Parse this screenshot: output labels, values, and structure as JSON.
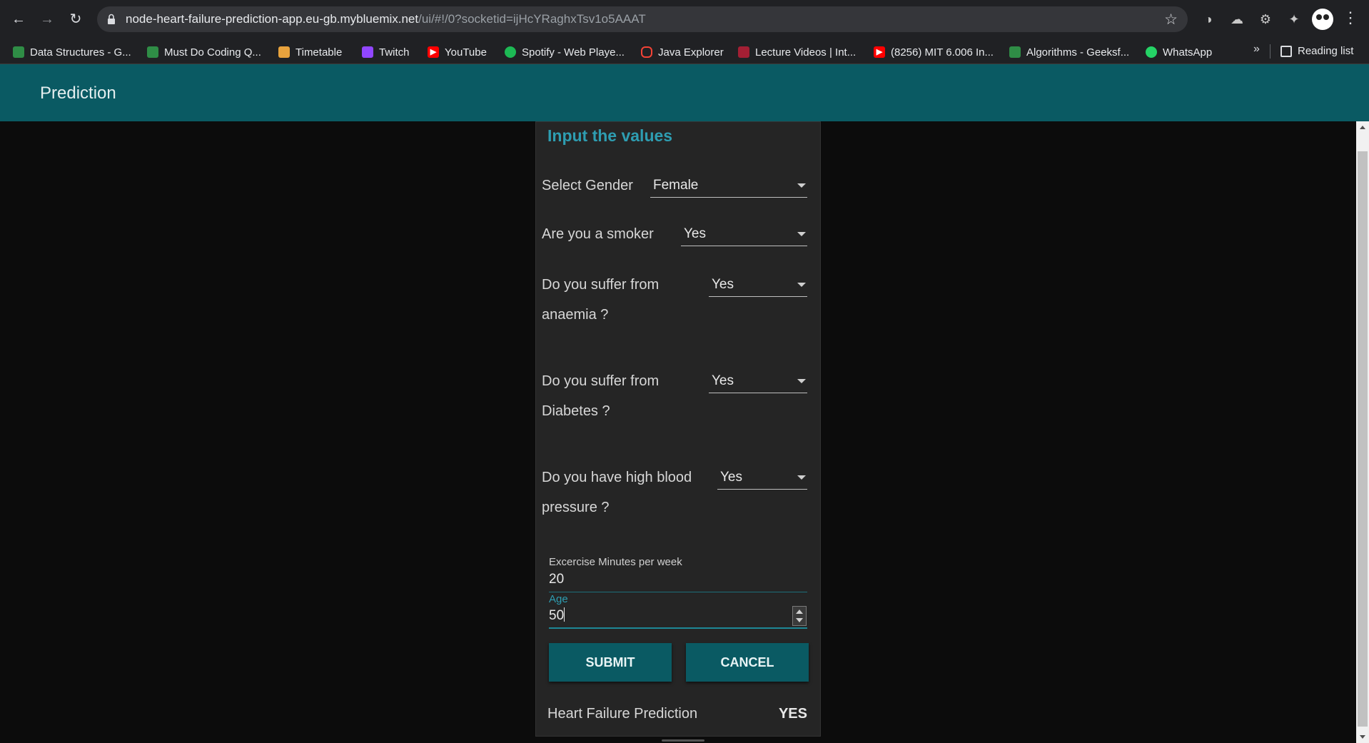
{
  "browser": {
    "url_host": "node-heart-failure-prediction-app.eu-gb.mybluemix.net",
    "url_path": "/ui/#!/0?socketid=ijHcYRaghxTsv1o5AAAT",
    "bookmarks": [
      {
        "label": "Data Structures - G...",
        "color": "#2f8d46"
      },
      {
        "label": "Must Do Coding Q...",
        "color": "#2f8d46"
      },
      {
        "label": "Timetable",
        "color": "#e8a33d"
      },
      {
        "label": "Twitch",
        "color": "#9146ff"
      },
      {
        "label": "YouTube",
        "color": "#ff0000"
      },
      {
        "label": "Spotify - Web Playe...",
        "color": "#1db954"
      },
      {
        "label": "Java Explorer",
        "color": "#f44336"
      },
      {
        "label": "Lecture Videos | Int...",
        "color": "#a31f34"
      },
      {
        "label": "(8256) MIT 6.006 In...",
        "color": "#ff0000"
      },
      {
        "label": "Algorithms - Geeksf...",
        "color": "#2f8d46"
      },
      {
        "label": "WhatsApp",
        "color": "#25d366"
      }
    ],
    "more": "»",
    "reading_list": "Reading list"
  },
  "app": {
    "title": "Prediction",
    "accent": "#0a5a63",
    "title_color": "#2e9db1"
  },
  "form": {
    "title": "Input the values",
    "gender": {
      "label": "Select Gender",
      "value": "Female"
    },
    "smoker": {
      "label": "Are you a smoker",
      "value": "Yes"
    },
    "anaemia": {
      "label_line1": "Do you suffer from",
      "label_line2": "anaemia ?",
      "value": "Yes"
    },
    "diabetes": {
      "label_line1": "Do you suffer from",
      "label_line2": "Diabetes ?",
      "value": "Yes"
    },
    "bp": {
      "label_line1": "Do you have high blood",
      "label_line2": "pressure ?",
      "value": "Yes"
    },
    "exercise": {
      "label": "Excercise Minutes per week",
      "value": "20"
    },
    "age": {
      "label": "Age",
      "value": "50"
    },
    "submit": "SUBMIT",
    "cancel": "CANCEL",
    "prediction_label": "Heart Failure Prediction",
    "prediction_value": "YES"
  }
}
